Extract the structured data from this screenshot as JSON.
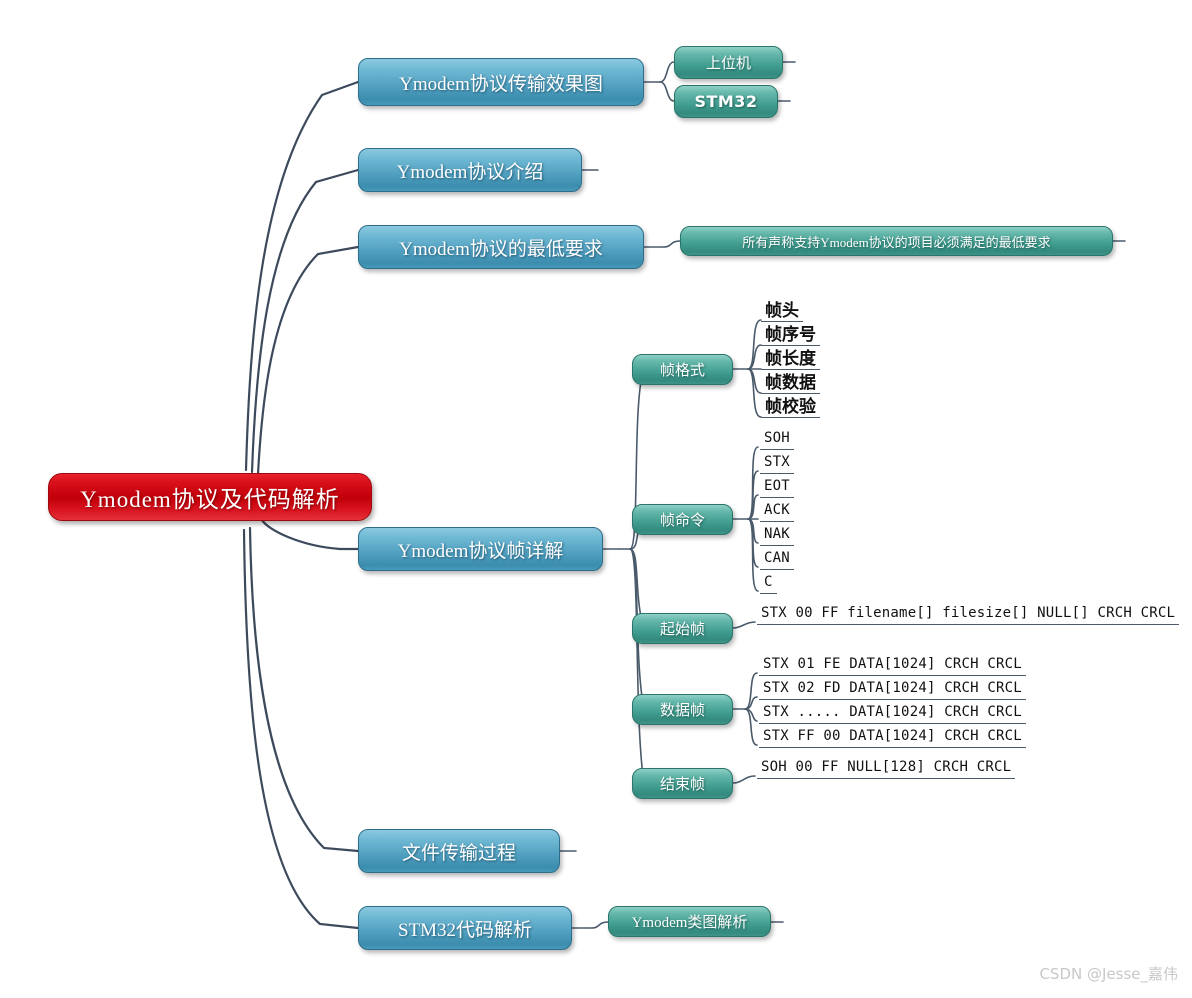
{
  "meta": {
    "watermark": "CSDN @Jesse_嘉伟",
    "colors": {
      "root_fill": "#c10009",
      "level1_fill": "#4f9ebf",
      "level2_fill": "#3f9c8e",
      "link_stroke": "#3d4a5c",
      "leaf_text": "#111111",
      "watermark_text": "#c8c8c8"
    }
  },
  "root": {
    "label": "Ymodem协议及代码解析"
  },
  "branches": [
    {
      "label": "Ymodem协议传输效果图",
      "children": [
        {
          "label": "上位机",
          "style": "cn"
        },
        {
          "label": "STM32",
          "style": "sans"
        }
      ]
    },
    {
      "label": "Ymodem协议介绍",
      "children": []
    },
    {
      "label": "Ymodem协议的最低要求",
      "children": [
        {
          "label": "所有声称支持Ymodem协议的项目必须满足的最低要求",
          "style": "cn"
        }
      ]
    },
    {
      "label": "Ymodem协议帧详解",
      "children": [
        {
          "label": "帧格式",
          "style": "cn",
          "leaves": [
            "帧头",
            "帧序号",
            "帧长度",
            "帧数据",
            "帧校验"
          ],
          "leaf_style": "cn"
        },
        {
          "label": "帧命令",
          "style": "cn",
          "leaves": [
            "SOH",
            "STX",
            "EOT",
            "ACK",
            "NAK",
            "CAN",
            "C"
          ],
          "leaf_style": "mono"
        },
        {
          "label": "起始帧",
          "style": "cn",
          "leaves": [
            "STX 00 FF filename[] filesize[] NULL[] CRCH CRCL"
          ],
          "leaf_style": "mono"
        },
        {
          "label": "数据帧",
          "style": "cn",
          "leaves": [
            "STX 01 FE DATA[1024] CRCH CRCL",
            "STX 02 FD DATA[1024] CRCH CRCL",
            "STX ..... DATA[1024] CRCH CRCL",
            "STX FF 00 DATA[1024] CRCH CRCL"
          ],
          "leaf_style": "mono"
        },
        {
          "label": "结束帧",
          "style": "cn",
          "leaves": [
            "SOH 00 FF NULL[128] CRCH CRCL"
          ],
          "leaf_style": "mono"
        }
      ]
    },
    {
      "label": "文件传输过程",
      "children": []
    },
    {
      "label": "STM32代码解析",
      "children": [
        {
          "label": "Ymodem类图解析",
          "style": "cn"
        }
      ]
    }
  ]
}
